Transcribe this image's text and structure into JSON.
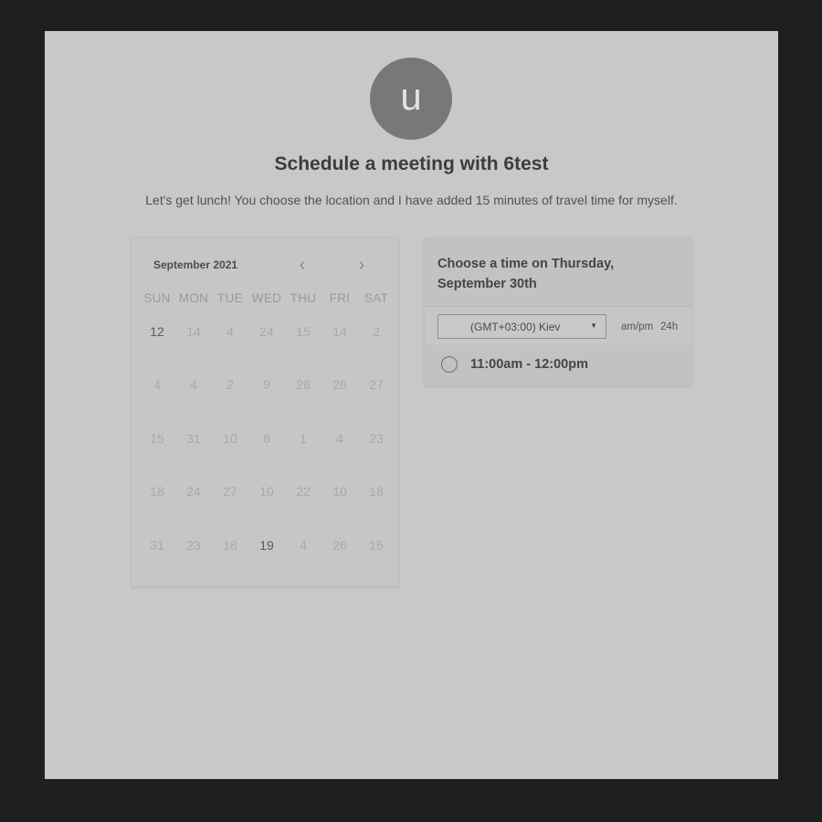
{
  "avatar": {
    "initial": "u"
  },
  "title": "Schedule a meeting with 6test",
  "description": "Let's get lunch! You choose the location and I have added 15 minutes of travel time for myself.",
  "calendar": {
    "month_label": "September 2021",
    "prev_icon": "chevron-left-icon",
    "next_icon": "chevron-right-icon",
    "prev_glyph": "‹",
    "next_glyph": "›",
    "weekdays": [
      "SUN",
      "MON",
      "TUE",
      "WED",
      "THU",
      "FRI",
      "SAT"
    ],
    "weeks": [
      [
        "12",
        "14",
        "4",
        "24",
        "15",
        "14",
        "2"
      ],
      [
        "4",
        "4",
        "2",
        "9",
        "26",
        "26",
        "27"
      ],
      [
        "15",
        "31",
        "10",
        "6",
        "1",
        "4",
        "23"
      ],
      [
        "18",
        "24",
        "27",
        "10",
        "22",
        "10",
        "18"
      ],
      [
        "31",
        "23",
        "18",
        "19",
        "4",
        "26",
        "15"
      ]
    ],
    "active_days": [
      [
        0,
        0
      ],
      [
        4,
        3
      ]
    ]
  },
  "time_picker": {
    "heading": "Choose a time on Thursday, September 30th",
    "timezone": "(GMT+03:00) Kiev",
    "format_ampm": "am/pm",
    "format_24h": "24h",
    "slots": [
      "11:00am - 12:00pm"
    ]
  },
  "colors": {
    "backdrop": "#1f1f1f",
    "page": "#c8c8c8",
    "avatar": "#787878"
  }
}
